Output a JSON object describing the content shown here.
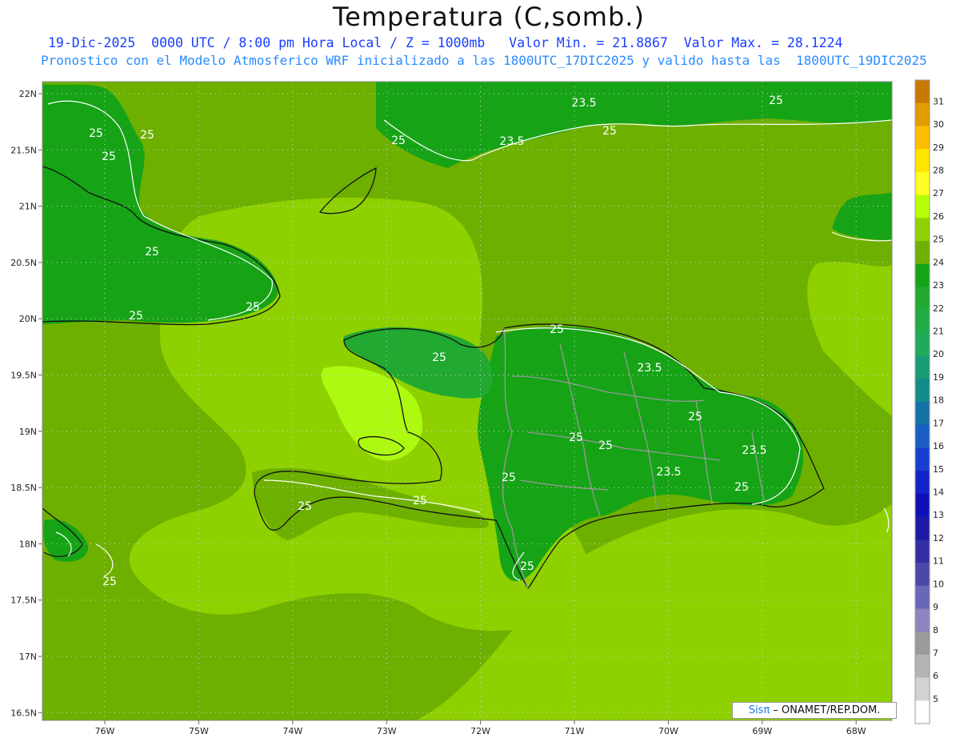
{
  "title": "Temperatura (C,somb.)",
  "subtitle_line1": "19-Dic-2025  0000 UTC / 8:00 pm Hora Local / Z = 1000mb   Valor Min. = 21.8867  Valor Max. = 28.1224",
  "subtitle_line2": "Pronostico con el Modelo Atmosferico WRF inicializado a las 1800UTC_17DIC2025 y valido hasta las  1800UTC_19DIC2025",
  "credit": {
    "brand": "Sisπ",
    "text": " – ONAMET/REP.DOM."
  },
  "map": {
    "lat_ticks": [
      "22N",
      "21.5N",
      "21N",
      "20.5N",
      "20N",
      "19.5N",
      "19N",
      "18.5N",
      "18N",
      "17.5N",
      "17N",
      "16.5N"
    ],
    "lon_ticks": [
      "76W",
      "75W",
      "74W",
      "73W",
      "72W",
      "71W",
      "70W",
      "69W",
      "68W"
    ],
    "contour_labels": [
      {
        "text": "23.5"
      },
      {
        "text": "23.5"
      },
      {
        "text": "25"
      },
      {
        "text": "25"
      },
      {
        "text": "25"
      },
      {
        "text": "25"
      },
      {
        "text": "25"
      },
      {
        "text": "25"
      },
      {
        "text": "25"
      },
      {
        "text": "25"
      },
      {
        "text": "25"
      },
      {
        "text": "25"
      },
      {
        "text": "25"
      },
      {
        "text": "23.5"
      },
      {
        "text": "25"
      },
      {
        "text": "25"
      },
      {
        "text": "25"
      },
      {
        "text": "23.5"
      },
      {
        "text": "23.5"
      },
      {
        "text": "25"
      },
      {
        "text": "25"
      },
      {
        "text": "25"
      },
      {
        "text": "25"
      },
      {
        "text": "25"
      },
      {
        "text": "25"
      }
    ]
  },
  "colorbar": {
    "labels": [
      "31",
      "30",
      "29",
      "28",
      "27",
      "26",
      "25",
      "24",
      "23",
      "22",
      "21",
      "20",
      "19",
      "18",
      "17",
      "16",
      "15",
      "14",
      "13",
      "12",
      "11",
      "10",
      "9",
      "8",
      "7",
      "6",
      "5"
    ],
    "colors": [
      "#c87800",
      "#e49b00",
      "#ffbd00",
      "#ffe600",
      "#ffff26",
      "#b6ff0a",
      "#8fd100",
      "#6fb000",
      "#16a316",
      "#21a931",
      "#22ac47",
      "#1eab5b",
      "#179d75",
      "#128b8a",
      "#1572a7",
      "#1a5ec4",
      "#173ed1",
      "#1224c8",
      "#0f0fb8",
      "#1e1aa6",
      "#332ea3",
      "#4b48ac",
      "#6a66b8",
      "#8f83c0",
      "#9a9a9a",
      "#b4b4b4",
      "#d2d2d2",
      "#ffffff"
    ]
  }
}
